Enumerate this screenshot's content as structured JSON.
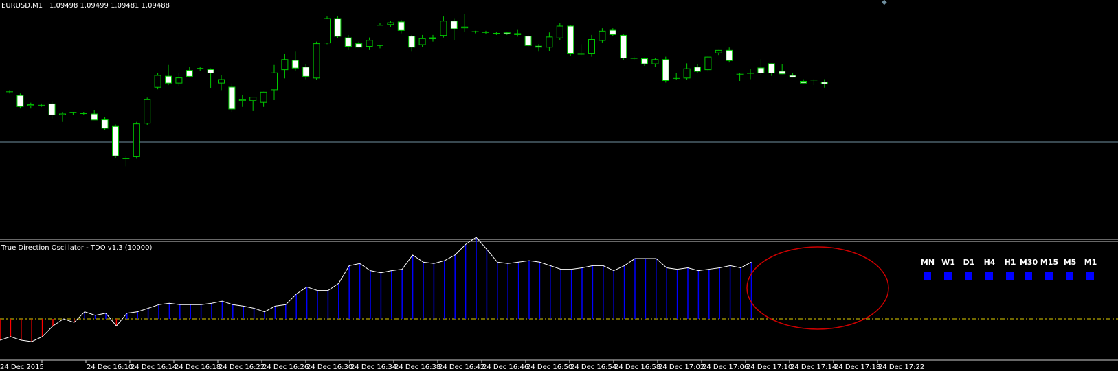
{
  "chart_data": [
    {
      "type": "candlestick",
      "title": "EURUSD,M1",
      "ohlc_header": "1.09498 1.09499 1.09481 1.09488",
      "price_line": 1.095,
      "ylim": [
        1.09395,
        1.09655
      ],
      "colors": {
        "bull_outline": "#00c800",
        "bear_fill": "#ffffff",
        "wick": "#00c800",
        "price_line": "#6f8fa0",
        "background": "#000000"
      },
      "candles": [
        {
          "o": 1.0956,
          "h": 1.09562,
          "l": 1.09558,
          "c": 1.0956
        },
        {
          "o": 1.09556,
          "h": 1.09558,
          "l": 1.0954,
          "c": 1.09542
        },
        {
          "o": 1.09543,
          "h": 1.09547,
          "l": 1.0954,
          "c": 1.09545
        },
        {
          "o": 1.09544,
          "h": 1.09546,
          "l": 1.09542,
          "c": 1.09544
        },
        {
          "o": 1.09546,
          "h": 1.09549,
          "l": 1.09528,
          "c": 1.09532
        },
        {
          "o": 1.09532,
          "h": 1.09536,
          "l": 1.09524,
          "c": 1.09534
        },
        {
          "o": 1.09534,
          "h": 1.09536,
          "l": 1.09532,
          "c": 1.09535
        },
        {
          "o": 1.09534,
          "h": 1.09536,
          "l": 1.09532,
          "c": 1.09534
        },
        {
          "o": 1.09534,
          "h": 1.09538,
          "l": 1.09531,
          "c": 1.09526
        },
        {
          "o": 1.09527,
          "h": 1.0953,
          "l": 1.09514,
          "c": 1.09516
        },
        {
          "o": 1.09519,
          "h": 1.09521,
          "l": 1.09481,
          "c": 1.09483
        },
        {
          "o": 1.0948,
          "h": 1.09483,
          "l": 1.09471,
          "c": 1.0948
        },
        {
          "o": 1.09482,
          "h": 1.09524,
          "l": 1.0948,
          "c": 1.09522
        },
        {
          "o": 1.09522,
          "h": 1.09553,
          "l": 1.0952,
          "c": 1.09551
        },
        {
          "o": 1.09565,
          "h": 1.09582,
          "l": 1.09563,
          "c": 1.0958
        },
        {
          "o": 1.09579,
          "h": 1.09592,
          "l": 1.09568,
          "c": 1.0957
        },
        {
          "o": 1.0957,
          "h": 1.09582,
          "l": 1.09567,
          "c": 1.09577
        },
        {
          "o": 1.09586,
          "h": 1.0959,
          "l": 1.09577,
          "c": 1.09578
        },
        {
          "o": 1.09587,
          "h": 1.0959,
          "l": 1.09585,
          "c": 1.09588
        },
        {
          "o": 1.09587,
          "h": 1.09588,
          "l": 1.09564,
          "c": 1.09582
        },
        {
          "o": 1.0957,
          "h": 1.0958,
          "l": 1.09562,
          "c": 1.09575
        },
        {
          "o": 1.09566,
          "h": 1.0957,
          "l": 1.09536,
          "c": 1.09539
        },
        {
          "o": 1.09549,
          "h": 1.09556,
          "l": 1.09542,
          "c": 1.09551
        },
        {
          "o": 1.09549,
          "h": 1.09553,
          "l": 1.09537,
          "c": 1.09554
        },
        {
          "o": 1.09547,
          "h": 1.0956,
          "l": 1.09542,
          "c": 1.0956
        },
        {
          "o": 1.09562,
          "h": 1.09592,
          "l": 1.0955,
          "c": 1.09583
        },
        {
          "o": 1.09586,
          "h": 1.09605,
          "l": 1.09576,
          "c": 1.09599
        },
        {
          "o": 1.09598,
          "h": 1.09608,
          "l": 1.09585,
          "c": 1.09588
        },
        {
          "o": 1.0959,
          "h": 1.09593,
          "l": 1.09575,
          "c": 1.09578
        },
        {
          "o": 1.09576,
          "h": 1.0962,
          "l": 1.09574,
          "c": 1.09618
        },
        {
          "o": 1.09618,
          "h": 1.0965,
          "l": 1.09617,
          "c": 1.09648
        },
        {
          "o": 1.09648,
          "h": 1.0965,
          "l": 1.09624,
          "c": 1.09626
        },
        {
          "o": 1.09625,
          "h": 1.09628,
          "l": 1.0961,
          "c": 1.09614
        },
        {
          "o": 1.09618,
          "h": 1.0962,
          "l": 1.09613,
          "c": 1.09613
        },
        {
          "o": 1.09614,
          "h": 1.09625,
          "l": 1.0961,
          "c": 1.09622
        },
        {
          "o": 1.09615,
          "h": 1.09642,
          "l": 1.09612,
          "c": 1.0964
        },
        {
          "o": 1.0964,
          "h": 1.09645,
          "l": 1.09637,
          "c": 1.09643
        },
        {
          "o": 1.09644,
          "h": 1.09646,
          "l": 1.0963,
          "c": 1.09633
        },
        {
          "o": 1.09627,
          "h": 1.09628,
          "l": 1.09608,
          "c": 1.09613
        },
        {
          "o": 1.09616,
          "h": 1.09628,
          "l": 1.09614,
          "c": 1.09624
        },
        {
          "o": 1.09625,
          "h": 1.09628,
          "l": 1.0962,
          "c": 1.09623
        },
        {
          "o": 1.09627,
          "h": 1.0965,
          "l": 1.09625,
          "c": 1.09645
        },
        {
          "o": 1.09645,
          "h": 1.09648,
          "l": 1.09622,
          "c": 1.09635
        },
        {
          "o": 1.09636,
          "h": 1.09653,
          "l": 1.09632,
          "c": 1.09638
        },
        {
          "o": 1.09632,
          "h": 1.09633,
          "l": 1.0963,
          "c": 1.09631
        },
        {
          "o": 1.09631,
          "h": 1.09633,
          "l": 1.09629,
          "c": 1.09631
        },
        {
          "o": 1.0963,
          "h": 1.09632,
          "l": 1.09628,
          "c": 1.0963
        },
        {
          "o": 1.09631,
          "h": 1.09632,
          "l": 1.09628,
          "c": 1.09629
        },
        {
          "o": 1.09628,
          "h": 1.09634,
          "l": 1.09626,
          "c": 1.0963
        },
        {
          "o": 1.09627,
          "h": 1.09628,
          "l": 1.09614,
          "c": 1.09615
        },
        {
          "o": 1.09615,
          "h": 1.09617,
          "l": 1.09608,
          "c": 1.09613
        },
        {
          "o": 1.09613,
          "h": 1.09631,
          "l": 1.09609,
          "c": 1.09626
        },
        {
          "o": 1.09624,
          "h": 1.09642,
          "l": 1.09622,
          "c": 1.09639
        },
        {
          "o": 1.09639,
          "h": 1.0964,
          "l": 1.09603,
          "c": 1.09605
        },
        {
          "o": 1.09605,
          "h": 1.09617,
          "l": 1.09604,
          "c": 1.09605
        },
        {
          "o": 1.09605,
          "h": 1.09628,
          "l": 1.09602,
          "c": 1.09623
        },
        {
          "o": 1.09621,
          "h": 1.09636,
          "l": 1.09619,
          "c": 1.09633
        },
        {
          "o": 1.09634,
          "h": 1.09636,
          "l": 1.09627,
          "c": 1.09628
        },
        {
          "o": 1.09628,
          "h": 1.09629,
          "l": 1.09598,
          "c": 1.096
        },
        {
          "o": 1.096,
          "h": 1.09602,
          "l": 1.09598,
          "c": 1.096
        },
        {
          "o": 1.096,
          "h": 1.09601,
          "l": 1.09591,
          "c": 1.09593
        },
        {
          "o": 1.09593,
          "h": 1.096,
          "l": 1.0959,
          "c": 1.09599
        },
        {
          "o": 1.09599,
          "h": 1.09602,
          "l": 1.09571,
          "c": 1.09573
        },
        {
          "o": 1.09576,
          "h": 1.09582,
          "l": 1.09574,
          "c": 1.09576
        },
        {
          "o": 1.09576,
          "h": 1.09594,
          "l": 1.09574,
          "c": 1.09588
        },
        {
          "o": 1.0959,
          "h": 1.09593,
          "l": 1.09583,
          "c": 1.09584
        },
        {
          "o": 1.09586,
          "h": 1.09603,
          "l": 1.09584,
          "c": 1.09602
        },
        {
          "o": 1.09606,
          "h": 1.0961,
          "l": 1.09604,
          "c": 1.0961
        },
        {
          "o": 1.0961,
          "h": 1.09613,
          "l": 1.09595,
          "c": 1.09597
        },
        {
          "o": 1.0958,
          "h": 1.09582,
          "l": 1.09573,
          "c": 1.09581
        },
        {
          "o": 1.09581,
          "h": 1.09587,
          "l": 1.09575,
          "c": 1.09582
        },
        {
          "o": 1.09589,
          "h": 1.09599,
          "l": 1.0958,
          "c": 1.09582
        },
        {
          "o": 1.09594,
          "h": 1.09594,
          "l": 1.09579,
          "c": 1.09582
        },
        {
          "o": 1.09585,
          "h": 1.09593,
          "l": 1.09581,
          "c": 1.09581
        },
        {
          "o": 1.0958,
          "h": 1.09582,
          "l": 1.09577,
          "c": 1.09577
        },
        {
          "o": 1.09573,
          "h": 1.09575,
          "l": 1.0957,
          "c": 1.0957
        },
        {
          "o": 1.09573,
          "h": 1.09575,
          "l": 1.09568,
          "c": 1.09574
        },
        {
          "o": 1.09572,
          "h": 1.09575,
          "l": 1.09565,
          "c": 1.09569
        }
      ],
      "x_ticks": [
        "24 Dec 2015",
        "24 Dec 16:10",
        "24 Dec 16:14",
        "24 Dec 16:18",
        "24 Dec 16:22",
        "24 Dec 16:26",
        "24 Dec 16:30",
        "24 Dec 16:34",
        "24 Dec 16:38",
        "24 Dec 16:42",
        "24 Dec 16:46",
        "24 Dec 16:50",
        "24 Dec 16:54",
        "24 Dec 16:58",
        "24 Dec 17:02",
        "24 Dec 17:06",
        "24 Dec 17:10",
        "24 Dec 17:14",
        "24 Dec 17:18",
        "24 Dec 17:22"
      ]
    },
    {
      "type": "histogram-oscillator",
      "title": "True Direction Oscillator - TDO v1.3 (10000)",
      "baseline": 0,
      "ylim": [
        -30,
        110
      ],
      "colors": {
        "positive": "#0000ff",
        "negative": "#ff0000",
        "line": "#ffffff",
        "baseline": "#e0d000",
        "ellipse": "#cc0000"
      },
      "values": [
        -30,
        -25,
        -30,
        -32,
        -25,
        -10,
        0,
        -5,
        10,
        5,
        8,
        -10,
        8,
        10,
        15,
        20,
        22,
        20,
        20,
        20,
        22,
        25,
        20,
        18,
        15,
        10,
        18,
        20,
        35,
        45,
        40,
        40,
        50,
        75,
        78,
        68,
        65,
        68,
        70,
        90,
        80,
        78,
        82,
        90,
        105,
        115,
        98,
        80,
        78,
        80,
        82,
        80,
        75,
        70,
        70,
        72,
        75,
        75,
        68,
        75,
        85,
        85,
        85,
        72,
        70,
        72,
        68,
        70,
        72,
        75,
        72,
        80
      ]
    }
  ],
  "timeframes": {
    "labels": [
      "MN",
      "W1",
      "D1",
      "H4",
      "H1",
      "M30",
      "M15",
      "M5",
      "M1"
    ],
    "indicator_color": "#0000ff"
  }
}
